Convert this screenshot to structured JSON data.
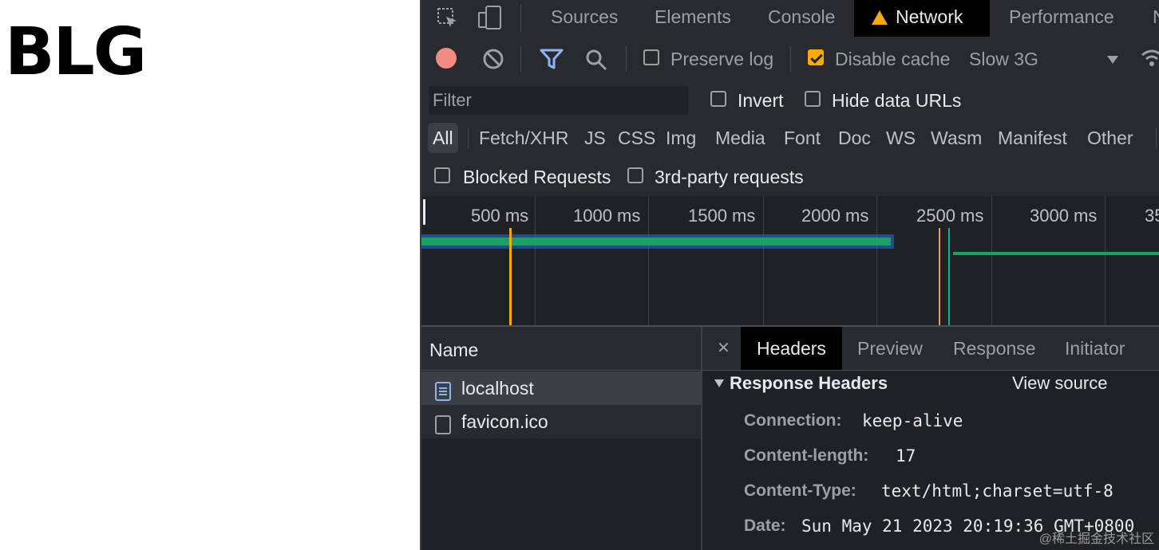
{
  "page": {
    "heading": "BLG"
  },
  "devtools": {
    "tabs": [
      {
        "label": "Sources"
      },
      {
        "label": "Elements"
      },
      {
        "label": "Console"
      },
      {
        "label": "Network",
        "active": true,
        "warning": true
      },
      {
        "label": "Performance"
      },
      {
        "label": "N"
      }
    ],
    "toolbar": {
      "preserve_log": {
        "label": "Preserve log",
        "checked": false
      },
      "disable_cache": {
        "label": "Disable cache",
        "checked": true
      },
      "throttling": "Slow 3G"
    },
    "filter": {
      "placeholder": "Filter",
      "invert": {
        "label": "Invert",
        "checked": false
      },
      "hide_data_urls": {
        "label": "Hide data URLs",
        "checked": false
      },
      "types": [
        "All",
        "Fetch/XHR",
        "JS",
        "CSS",
        "Img",
        "Media",
        "Font",
        "Doc",
        "WS",
        "Wasm",
        "Manifest",
        "Other"
      ],
      "active_type": "All",
      "blocked_requests": {
        "label": "Blocked Requests",
        "checked": false
      },
      "third_party": {
        "label": "3rd-party requests",
        "checked": false
      }
    },
    "timeline": {
      "ticks": [
        "500 ms",
        "1000 ms",
        "1500 ms",
        "2000 ms",
        "2500 ms",
        "3000 ms",
        "35"
      ]
    },
    "requests": {
      "column_header": "Name",
      "items": [
        {
          "name": "localhost",
          "type": "document",
          "selected": true
        },
        {
          "name": "favicon.ico",
          "type": "other",
          "selected": false
        }
      ]
    },
    "details": {
      "close_glyph": "✕",
      "tabs": [
        "Headers",
        "Preview",
        "Response",
        "Initiator"
      ],
      "active_tab": "Headers",
      "section_title": "Response Headers",
      "view_source": "View source",
      "headers": [
        {
          "key": "Connection:",
          "value": "keep-alive"
        },
        {
          "key": "Content-length:",
          "value": "17"
        },
        {
          "key": "Content-Type:",
          "value": "text/html;charset=utf-8"
        },
        {
          "key": "Date:",
          "value": "Sun May 21 2023 20:19:36 GMT+0800"
        }
      ]
    },
    "watermark": "@稀土掘金技术社区",
    "colors": {
      "record": "#f28b82",
      "accent": "#8ab4f8",
      "checkbox": "#f9ab00",
      "bar": "#1aa260"
    }
  }
}
